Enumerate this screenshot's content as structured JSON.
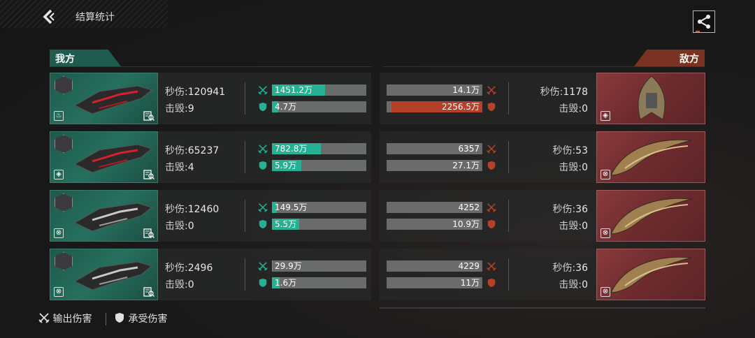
{
  "header": {
    "title": "结算统计"
  },
  "sides": {
    "ally_label": "我方",
    "enemy_label": "敌方"
  },
  "labels": {
    "dps": "秒伤:",
    "kills": "击毁:"
  },
  "colors": {
    "ally_accent": "#27b194",
    "enemy_accent": "#b5412a",
    "bar_bg": "#6a6b6b"
  },
  "ally": [
    {
      "dps": "120941",
      "kills": "9",
      "damage_dealt": "1451.2万",
      "dealt_fill": 0.56,
      "damage_taken": "4.7万",
      "taken_fill": 0.07,
      "role_icon": "flame-icon"
    },
    {
      "dps": "65237",
      "kills": "4",
      "damage_dealt": "782.8万",
      "dealt_fill": 0.52,
      "damage_taken": "5.9万",
      "taken_fill": 0.31,
      "role_icon": "shield-icon"
    },
    {
      "dps": "12460",
      "kills": "0",
      "damage_dealt": "149.5万",
      "dealt_fill": 0.05,
      "damage_taken": "5.5万",
      "taken_fill": 0.29,
      "role_icon": "crosshair-icon"
    },
    {
      "dps": "2496",
      "kills": "0",
      "damage_dealt": "29.9万",
      "dealt_fill": 0.01,
      "damage_taken": "1.6万",
      "taken_fill": 0.08,
      "role_icon": "crosshair-icon"
    }
  ],
  "enemy": [
    {
      "dps": "1178",
      "kills": "0",
      "damage_dealt": "14.1万",
      "dealt_fill": 0.01,
      "damage_taken": "2256.5万",
      "taken_fill": 0.95,
      "role_icon": "shield-icon"
    },
    {
      "dps": "53",
      "kills": "0",
      "damage_dealt": "6357",
      "dealt_fill": 0.0,
      "damage_taken": "27.1万",
      "taken_fill": 0.01,
      "role_icon": "crosshair-icon"
    },
    {
      "dps": "36",
      "kills": "0",
      "damage_dealt": "4252",
      "dealt_fill": 0.0,
      "damage_taken": "10.9万",
      "taken_fill": 0.01,
      "role_icon": "crosshair-icon"
    },
    {
      "dps": "36",
      "kills": "0",
      "damage_dealt": "4229",
      "dealt_fill": 0.0,
      "damage_taken": "11万",
      "taken_fill": 0.01,
      "role_icon": "crosshair-icon"
    }
  ],
  "legend": {
    "dealt_label": "输出伤害",
    "taken_label": "承受伤害"
  }
}
